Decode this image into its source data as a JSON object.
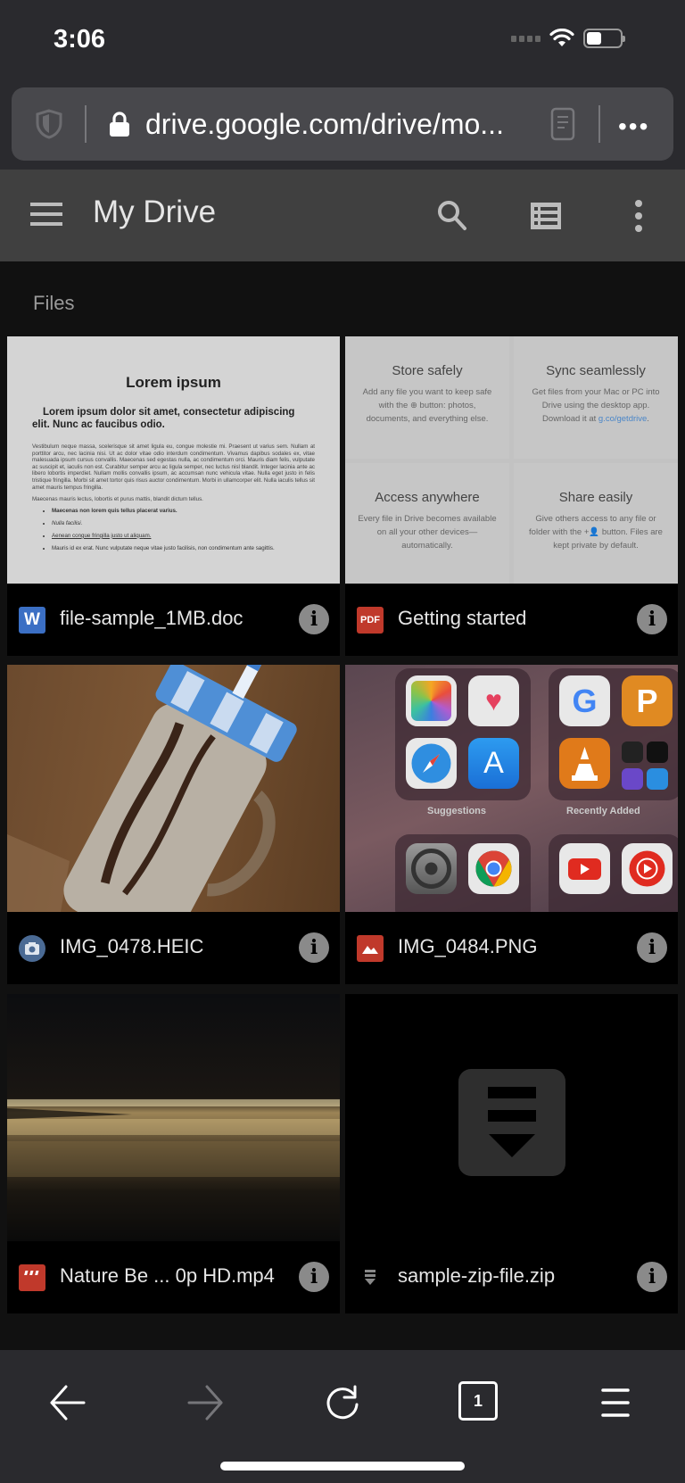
{
  "status_bar": {
    "time": "3:06"
  },
  "browser": {
    "url": "drive.google.com/drive/mo...",
    "more_label": "•••",
    "tab_count": "1"
  },
  "header": {
    "title": "My Drive"
  },
  "section_label": "Files",
  "files": [
    {
      "name": "file-sample_1MB.doc",
      "type": "word",
      "icon_label": "W",
      "icon_color": "#3b6fc4"
    },
    {
      "name": "Getting started",
      "type": "pdf",
      "icon_label": "PDF",
      "icon_color": "#c0392b"
    },
    {
      "name": "IMG_0478.HEIC",
      "type": "photo",
      "icon_color": "#4a6a94"
    },
    {
      "name": "IMG_0484.PNG",
      "type": "image",
      "icon_color": "#c0392b"
    },
    {
      "name": "Nature Be ... 0p HD.mp4",
      "type": "video",
      "icon_color": "#c0392b"
    },
    {
      "name": "sample-zip-file.zip",
      "type": "archive",
      "icon_color": "#777777"
    }
  ],
  "doc_preview": {
    "title": "Lorem ipsum",
    "subtitle": "Lorem ipsum dolor sit amet, consectetur adipiscing elit. Nunc ac faucibus odio.",
    "paragraph": "Vestibulum neque massa, scelerisque sit amet ligula eu, congue molestie mi. Praesent ut varius sem. Nullam at porttitor arcu, nec lacinia nisi. Ut ac dolor vitae odio interdum condimentum. Vivamus dapibus sodales ex, vitae malesuada ipsum cursus convallis. Maecenas sed egestas nulla, ac condimentum orci. Mauris diam felis, vulputate ac suscipit et, iaculis non est. Curabitur semper arcu ac ligula semper, nec luctus nisl blandit. Integer lacinia ante ac libero lobortis imperdiet. Nullam mollis convallis ipsum, ac accumsan nunc vehicula vitae. Nulla eget justo in felis tristique fringilla. Morbi sit amet tortor quis risus auctor condimentum. Morbi in ullamcorper elit. Nulla iaculis tellus sit amet mauris tempus fringilla.",
    "paragraph2": "Maecenas mauris lectus, lobortis et purus mattis, blandit dictum tellus.",
    "bullets": [
      "Maecenas non lorem quis tellus placerat varius.",
      "Nulla facilisi.",
      "Aenean congue fringilla justo ut aliquam.",
      "Mauris id ex erat. Nunc vulputate neque vitae justo facilisis, non condimentum ante sagittis."
    ]
  },
  "getting_started_preview": {
    "cells": [
      {
        "title": "Store safely",
        "body": "Add any file you want to keep safe with the ⊕ button: photos, documents, and everything else."
      },
      {
        "title": "Sync seamlessly",
        "body": "Get files from your Mac or PC into Drive using the desktop app. Download it at ",
        "link": "g.co/getdrive"
      },
      {
        "title": "Access anywhere",
        "body": "Every file in Drive becomes available on all your other devices—automatically."
      },
      {
        "title": "Share easily",
        "body": "Give others access to any file or folder with the +👤 button. Files are kept private by default."
      }
    ]
  },
  "apps_preview": {
    "folders": [
      "Suggestions",
      "Recently Added"
    ]
  }
}
